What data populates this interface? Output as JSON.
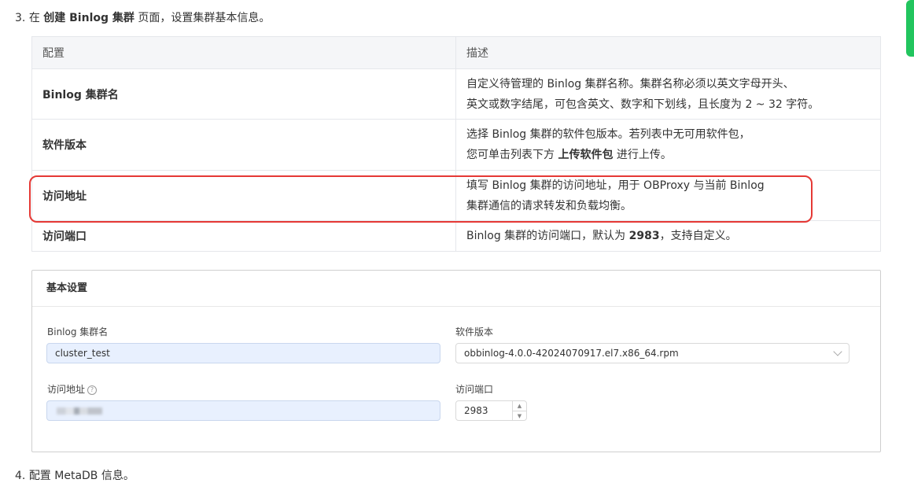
{
  "step3": {
    "number": "3.",
    "pre": "在",
    "bold": "创建 Binlog 集群",
    "post": "页面，设置集群基本信息。"
  },
  "table": {
    "headers": [
      "配置",
      "描述"
    ],
    "rows": [
      {
        "name": "Binlog 集群名",
        "desc1": "自定义待管理的 Binlog 集群名称。集群名称必须以英文字母开头、",
        "desc2": "英文或数字结尾，可包含英文、数字和下划线，且长度为 2 ~ 32 字符。"
      },
      {
        "name": "软件版本",
        "desc1": "选择 Binlog 集群的软件包版本。若列表中无可用软件包，",
        "desc2_pre": "您可单击列表下方",
        "desc2_bold": "上传软件包",
        "desc2_post": "进行上传。"
      },
      {
        "name": "访问地址",
        "desc1": "填写 Binlog 集群的访问地址，用于 OBProxy 与当前 Binlog",
        "desc2": "集群通信的请求转发和负载均衡。"
      },
      {
        "name": "访问端口",
        "desc_pre": "Binlog 集群的访问端口，默认为",
        "desc_bold": "2983",
        "desc_post": "，支持自定义。"
      }
    ]
  },
  "form": {
    "title": "基本设置",
    "cluster_name_label": "Binlog 集群名",
    "cluster_name_value": "cluster_test",
    "version_label": "软件版本",
    "version_value": "obbinlog-4.0.0-42024070917.el7.x86_64.rpm",
    "address_label": "访问地址",
    "help_glyph": "?",
    "port_label": "访问端口",
    "port_value": "2983",
    "stepper_up": "▲",
    "stepper_down": "▼"
  },
  "step4": {
    "number": "4.",
    "text": "配置 MetaDB 信息。"
  },
  "colors": {
    "highlight": "#e53935",
    "accent_tab": "#22c55e",
    "input_fill": "#e8f0fe"
  }
}
